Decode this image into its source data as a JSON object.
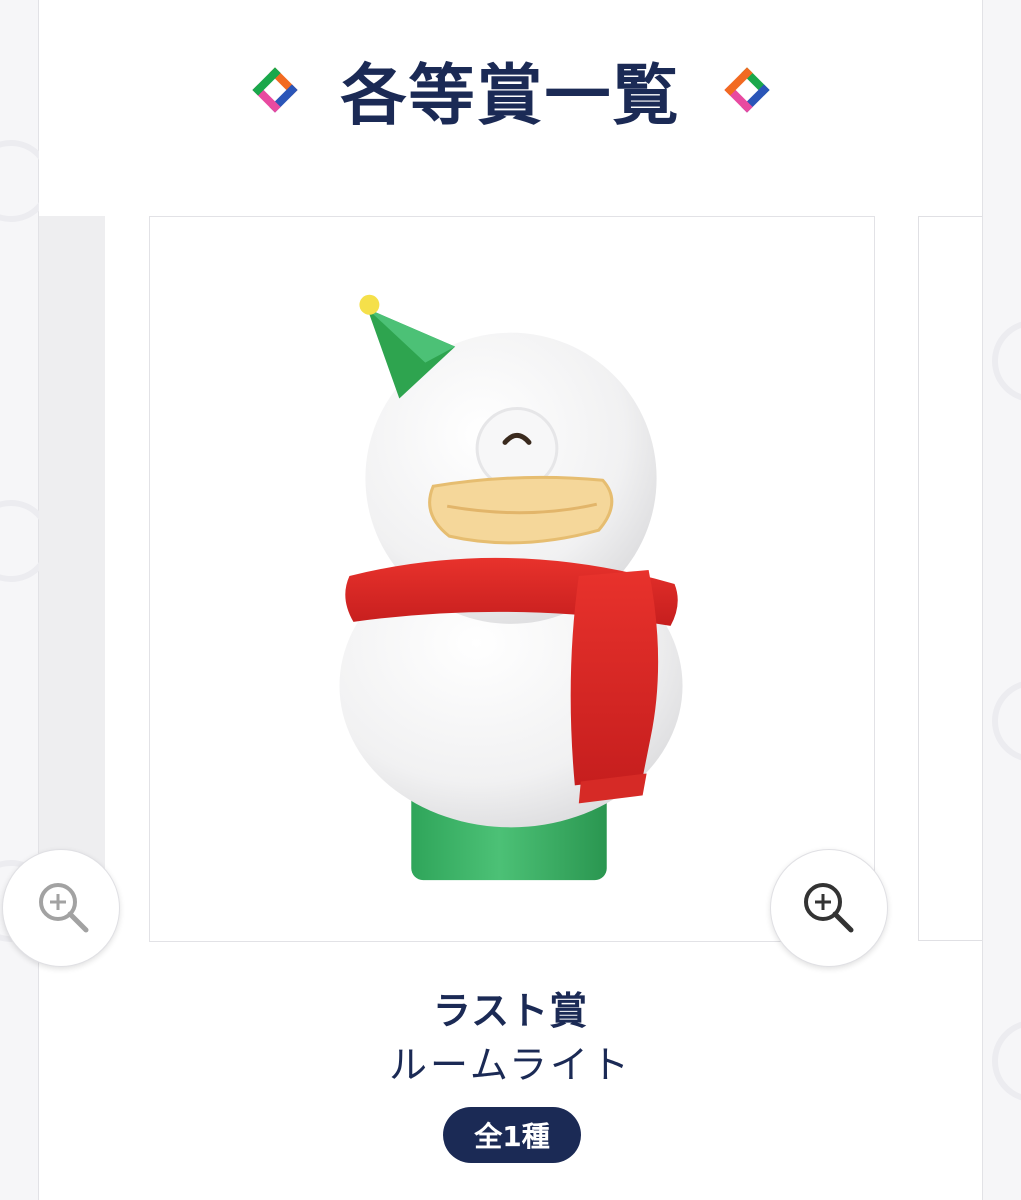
{
  "section": {
    "title": "各等賞一覧"
  },
  "prize": {
    "rank": "ラスト賞",
    "name": "ルームライト",
    "count_badge": "全1種"
  },
  "icons": {
    "decor": "diamond-logo-icon",
    "zoom": "zoom-in-icon"
  },
  "colors": {
    "navy": "#1b2a55",
    "logo_orange": "#f26a21",
    "logo_green": "#1aa84b",
    "logo_pink": "#e84aa0",
    "logo_blue": "#2a55b8"
  }
}
